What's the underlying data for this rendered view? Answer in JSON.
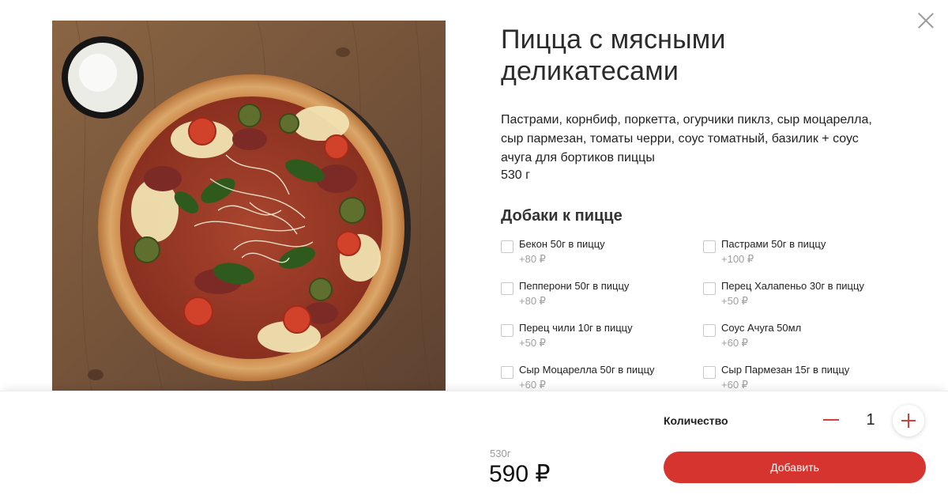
{
  "product": {
    "title_line1": "Пицца с мясными",
    "title_line2": "деликатесами",
    "description_line1": "Пастрами, корнбиф, поркетта, огурчики пиклз, сыр моцарелла,",
    "description_line2": "сыр пармезан, томаты черри, соус томатный, базилик + соус",
    "description_line3": "ачуга для бортиков пиццы",
    "weight": "530 г"
  },
  "addons": {
    "title": "Добаки к пицце",
    "items": [
      {
        "name": "Бекон 50г в пиццу",
        "price": "+80 ₽"
      },
      {
        "name": "Пастрами 50г в пиццу",
        "price": "+100 ₽"
      },
      {
        "name": "Пепперони 50г в пиццу",
        "price": "+80 ₽"
      },
      {
        "name": "Перец Халапеньо 30г в пиццу",
        "price": "+50 ₽"
      },
      {
        "name": "Перец чили 10г в пиццу",
        "price": "+50 ₽"
      },
      {
        "name": "Соус Ачуга 50мл",
        "price": "+60 ₽"
      },
      {
        "name": "Сыр Моцарелла 50г в пиццу",
        "price": "+60 ₽"
      },
      {
        "name": "Сыр Пармезан 15г в пиццу",
        "price": "+60 ₽"
      }
    ]
  },
  "footer": {
    "quantity_label": "Количество",
    "quantity_value": "1",
    "weight": "530г",
    "price": "590 ₽",
    "add_button_label": "Добавить"
  },
  "colors": {
    "accent": "#d6352f",
    "muted_text": "#a0a0a0",
    "wood": "#7a5738"
  },
  "icons": [
    "close-icon",
    "minus-icon",
    "plus-icon",
    "checkbox-icon"
  ]
}
